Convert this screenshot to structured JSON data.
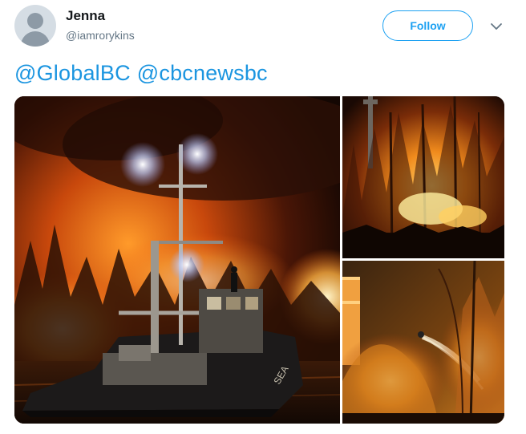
{
  "user": {
    "name": "Jenna",
    "handle": "@iamrorykins",
    "avatar_icon": "default-avatar-icon"
  },
  "follow_button": {
    "label": "Follow"
  },
  "menu": {
    "icon": "chevron-down-icon"
  },
  "tweet": {
    "mentions": [
      "@GlobalBC",
      "@cbcnewsbc"
    ]
  },
  "media": {
    "photos": [
      {
        "name": "tugboat-fire-photo"
      },
      {
        "name": "forest-fire-photo"
      },
      {
        "name": "firefighting-water-photo"
      }
    ],
    "boat_hull_text": "SEA"
  },
  "colors": {
    "accent": "#1da1f2",
    "link": "#1b95e0",
    "name": "#14171a",
    "secondary": "#657786"
  }
}
